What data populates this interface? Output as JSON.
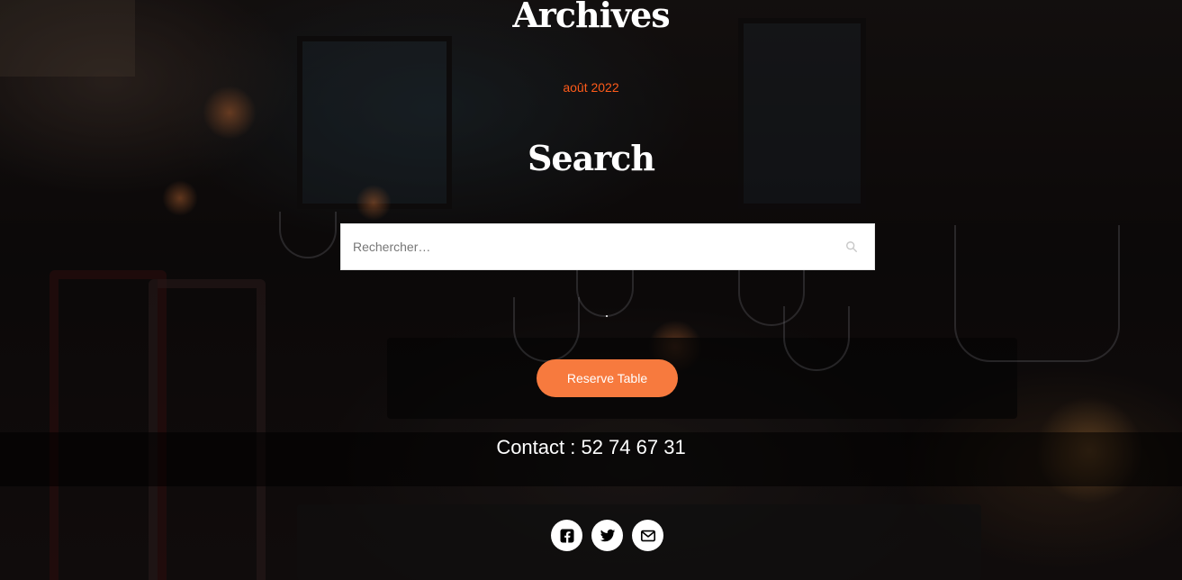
{
  "archives": {
    "title": "Archives",
    "items": [
      "août 2022"
    ]
  },
  "search": {
    "title": "Search",
    "placeholder": "Rechercher…"
  },
  "reserve": {
    "label": "Reserve Table"
  },
  "contact": {
    "text": "Contact : 52 74 67 31"
  },
  "social": {
    "icons": [
      "facebook-icon",
      "twitter-icon",
      "email-icon"
    ]
  },
  "colors": {
    "accent": "#f77a3e",
    "link": "#ff5b1a"
  }
}
